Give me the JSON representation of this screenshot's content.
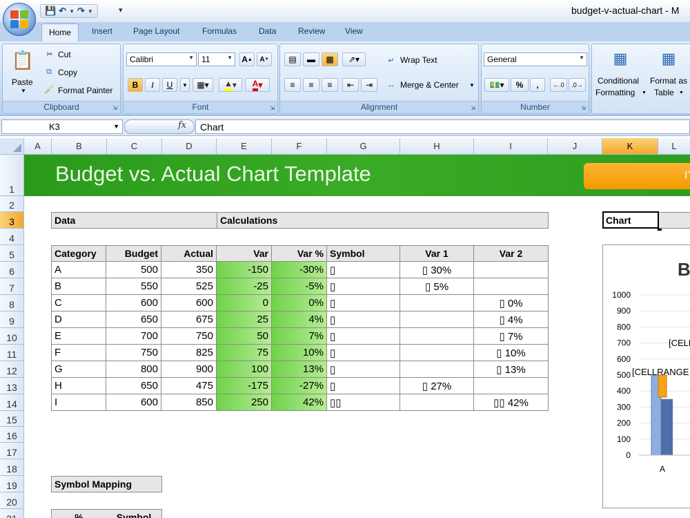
{
  "window": {
    "title": "budget-v-actual-chart - M"
  },
  "ribbon_tabs": [
    "Home",
    "Insert",
    "Page Layout",
    "Formulas",
    "Data",
    "Review",
    "View"
  ],
  "clipboard": {
    "paste": "Paste",
    "cut": "Cut",
    "copy": "Copy",
    "format_painter": "Format Painter",
    "label": "Clipboard"
  },
  "font": {
    "name": "Calibri",
    "size": "11",
    "bold": "B",
    "italic": "I",
    "underline": "U",
    "label": "Font"
  },
  "alignment": {
    "wrap_text": "Wrap Text",
    "merge_center": "Merge & Center",
    "label": "Alignment"
  },
  "number": {
    "format": "General",
    "percent": "%",
    "comma": ",",
    "label": "Number"
  },
  "styles": {
    "conditional_1": "Conditional",
    "conditional_2": "Formatting",
    "format_as_1": "Format as",
    "format_as_2": "Table"
  },
  "formula_bar": {
    "name_box": "K3",
    "fx": "fx",
    "content": "Chart"
  },
  "columns": [
    {
      "id": "A",
      "w": 40
    },
    {
      "id": "B",
      "w": 80
    },
    {
      "id": "C",
      "w": 80
    },
    {
      "id": "D",
      "w": 79
    },
    {
      "id": "E",
      "w": 80
    },
    {
      "id": "F",
      "w": 80
    },
    {
      "id": "G",
      "w": 106
    },
    {
      "id": "H",
      "w": 107
    },
    {
      "id": "I",
      "w": 107
    },
    {
      "id": "J",
      "w": 79
    },
    {
      "id": "K",
      "w": 81
    },
    {
      "id": "L",
      "w": 47
    }
  ],
  "selected_column": "K",
  "selected_row": "3",
  "rows": [
    "1",
    "2",
    "3",
    "4",
    "5",
    "6",
    "7",
    "8",
    "9",
    "10",
    "11",
    "12",
    "13",
    "14",
    "15",
    "16",
    "17",
    "18",
    "19",
    "20",
    "21"
  ],
  "banner": {
    "title": "Budget vs. Actual Chart Template",
    "badge": "IT"
  },
  "sections": {
    "data": "Data",
    "calculations": "Calculations",
    "chart": "Chart",
    "symbol_mapping": "Symbol Mapping"
  },
  "table": {
    "headers": [
      "Category",
      "Budget",
      "Actual",
      "Var",
      "Var %",
      "Symbol",
      "Var 1",
      "Var 2"
    ],
    "rows": [
      [
        "A",
        "500",
        "350",
        "-150",
        "-30%",
        "▯",
        "▯ 30%",
        ""
      ],
      [
        "B",
        "550",
        "525",
        "-25",
        "-5%",
        "▯",
        "▯ 5%",
        ""
      ],
      [
        "C",
        "600",
        "600",
        "0",
        "0%",
        "▯",
        "",
        "▯ 0%"
      ],
      [
        "D",
        "650",
        "675",
        "25",
        "4%",
        "▯",
        "",
        "▯ 4%"
      ],
      [
        "E",
        "700",
        "750",
        "50",
        "7%",
        "▯",
        "",
        "▯ 7%"
      ],
      [
        "F",
        "750",
        "825",
        "75",
        "10%",
        "▯",
        "",
        "▯ 10%"
      ],
      [
        "G",
        "800",
        "900",
        "100",
        "13%",
        "▯",
        "",
        "▯ 13%"
      ],
      [
        "H",
        "650",
        "475",
        "-175",
        "-27%",
        "▯",
        "▯ 27%",
        ""
      ],
      [
        "I",
        "600",
        "850",
        "250",
        "42%",
        "▯▯",
        "",
        "▯▯ 42%"
      ]
    ]
  },
  "symbol_table_headers": [
    "%",
    "Symbol"
  ],
  "chart": {
    "title_partial": "B",
    "y_ticks": [
      "1000",
      "900",
      "800",
      "700",
      "600",
      "500",
      "400",
      "300",
      "200",
      "100",
      "0"
    ],
    "label_1": "[CELL",
    "label_2": "[CELLRANGE",
    "x_label": "A"
  },
  "chart_data": {
    "type": "bar",
    "categories": [
      "A"
    ],
    "series": [
      {
        "values": [
          500
        ]
      },
      {
        "values": [
          350
        ]
      }
    ],
    "ylim": [
      0,
      1000
    ]
  }
}
